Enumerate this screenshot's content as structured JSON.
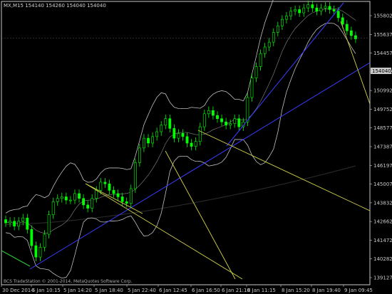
{
  "header": {
    "symbol_tf": "MX,M15",
    "ohlc": "154140 154260 154040 154040"
  },
  "price_axis": {
    "labels": [
      "155802",
      "155637",
      "154457",
      "153302",
      "150992",
      "149752",
      "148577",
      "147387",
      "146197",
      "145007",
      "143832",
      "142662",
      "141472",
      "140282",
      "139127"
    ],
    "current_price": "154040"
  },
  "time_axis": {
    "labels": [
      "30 Dec 2014",
      "5 Jan 10:15",
      "5 Jan 14:20",
      "5 Jan 18:40",
      "5 Jan 22:40",
      "6 Jan 12:45",
      "6 Jan 16:50",
      "6 Jan 21:10",
      "8 Jan 11:15",
      "8 Jan 15:20",
      "8 Jan 19:40",
      "9 Jan 09:45"
    ]
  },
  "footer": {
    "copyright": "BCS TradeStation © 2001-2014, MetaQuotes Software Corp."
  },
  "colors": {
    "background": "#000000",
    "axis": "#c8c8c8",
    "candle_body": "#000000",
    "candle_outline": "#00ff00",
    "bollinger": "#c0c0c0",
    "ma": "#000000",
    "trendline_blue": "#3b3bff",
    "fan_yellow": "#d6d64a",
    "green_line": "#2ecc40",
    "price_marker_bg": "#c8c8c8"
  },
  "chart_data": {
    "type": "candlestick",
    "title": "MX,M15",
    "y_axis_labels": [
      "155802",
      "155637",
      "154457",
      "153302",
      "150992",
      "149752",
      "148577",
      "147387",
      "146197",
      "145007",
      "143832",
      "142662",
      "141472",
      "140282",
      "139127"
    ],
    "x_axis_labels": [
      "30 Dec 2014",
      "5 Jan 10:15",
      "5 Jan 14:20",
      "5 Jan 18:40",
      "5 Jan 22:40",
      "6 Jan 12:45",
      "6 Jan 16:50",
      "6 Jan 21:10",
      "8 Jan 11:15",
      "8 Jan 15:20",
      "8 Jan 19:40",
      "9 Jan 09:45"
    ],
    "last_price": "154040",
    "series_close": [
      142700,
      142800,
      142500,
      142800,
      143000,
      142300,
      141300,
      140600,
      141200,
      142000,
      143200,
      144000,
      144200,
      144300,
      144100,
      144100,
      144500,
      144200,
      143800,
      143600,
      144200,
      144700,
      145200,
      145100,
      144700,
      144500,
      144300,
      144000,
      143900,
      144800,
      146400,
      147300,
      147900,
      147600,
      148000,
      148300,
      148700,
      149100,
      148500,
      147900,
      148200,
      148000,
      147600,
      147400,
      147700,
      148600,
      149400,
      149600,
      149300,
      149100,
      148900,
      148700,
      148800,
      149100,
      148600,
      148900,
      150400,
      151600,
      152300,
      153100,
      153500,
      153800,
      154400,
      154800,
      155200,
      155400,
      155700,
      155800,
      155600,
      155900,
      156100,
      155900,
      155700,
      155900,
      156000,
      155800,
      155700,
      155300,
      154900,
      154500,
      154200,
      154000
    ]
  }
}
